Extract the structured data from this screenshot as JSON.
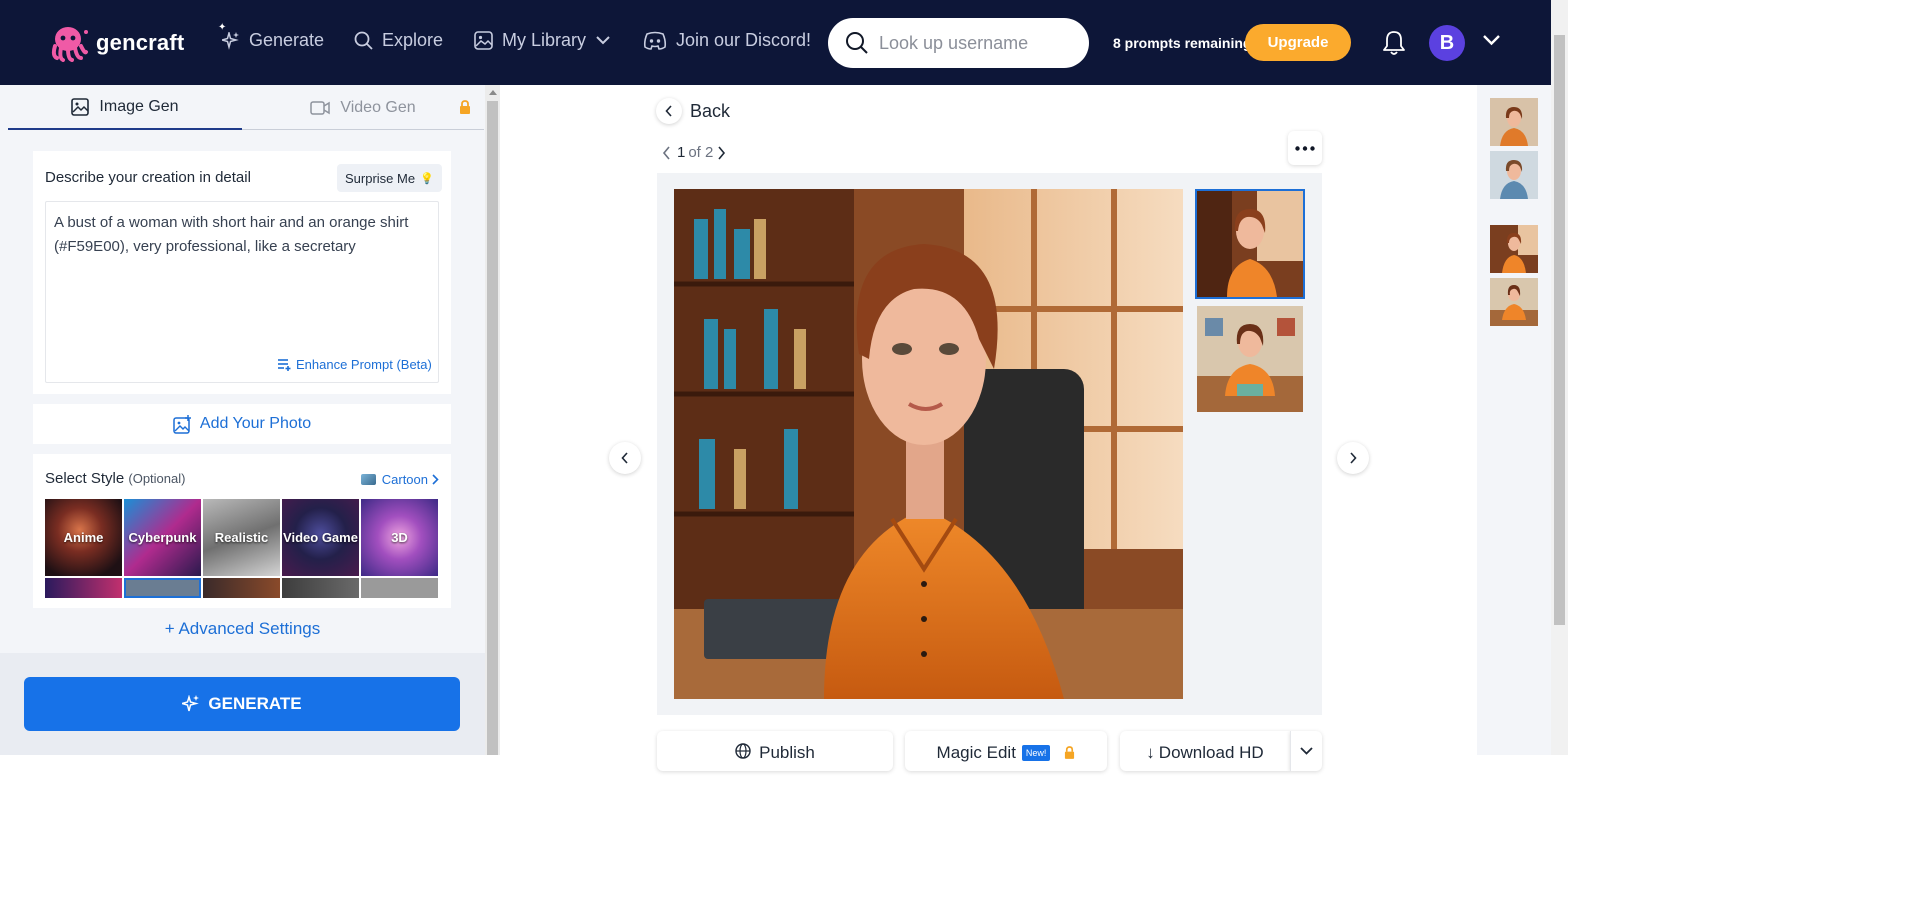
{
  "header": {
    "logo_text": "gencraft",
    "nav": [
      {
        "label": "Generate",
        "icon": "sparkle-icon"
      },
      {
        "label": "Explore",
        "icon": "search-icon"
      },
      {
        "label": "My Library",
        "icon": "library-icon"
      },
      {
        "label": "Join our Discord!",
        "icon": "discord-icon"
      }
    ],
    "search_placeholder": "Look up username",
    "prompts_remaining": "8 prompts remaining",
    "upgrade_label": "Upgrade",
    "avatar_initial": "B",
    "colors": {
      "nav_bg": "#0d1638",
      "upgrade": "#fbaa2d",
      "avatar": "#5b41e0"
    }
  },
  "left_panel": {
    "tabs": [
      {
        "label": "Image Gen",
        "active": true
      },
      {
        "label": "Video Gen",
        "active": false,
        "locked": true
      }
    ],
    "describe_label": "Describe your creation in detail",
    "surprise_label": "Surprise Me",
    "prompt_text": "A bust of a woman with short hair and an orange shirt (#F59E00), very professional, like a secretary",
    "enhance_label": "Enhance Prompt (Beta)",
    "add_photo_label": "Add Your Photo",
    "style_title": "Select Style",
    "style_optional": "(Optional)",
    "selected_style": "Cartoon",
    "styles": [
      "Anime",
      "Cyberpunk",
      "Realistic",
      "Video Game",
      "3D"
    ],
    "advanced_label": "+ Advanced Settings",
    "generate_label": "GENERATE",
    "colors": {
      "accent": "#1772e8",
      "link": "#1d6fd6"
    }
  },
  "main": {
    "back_label": "Back",
    "pager": {
      "current": "1",
      "of_text": "of 2"
    },
    "actions": {
      "publish": "Publish",
      "magic_edit": "Magic Edit",
      "new_badge": "New!",
      "download": "Download HD"
    }
  }
}
